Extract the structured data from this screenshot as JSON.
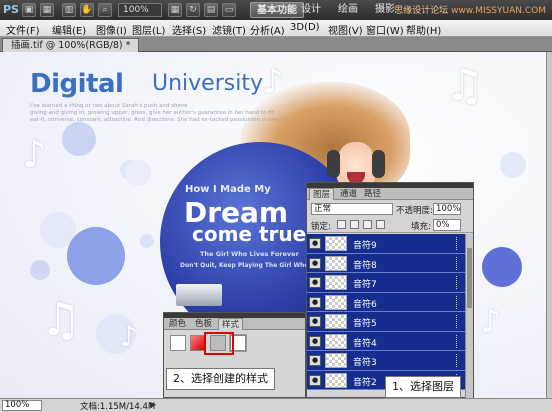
{
  "app": {
    "logo": "PS"
  },
  "toolbar": {
    "zoom": "100%",
    "workspace_basic": "基本功能",
    "workspace_design": "设计",
    "workspace_paint": "绘画",
    "workspace_more": "摄影",
    "watermark_brand": "思缘设计论坛",
    "watermark_site": "www.MISSYUAN.COM"
  },
  "menu": {
    "items": [
      "文件(F)",
      "编辑(E)",
      "图像(I)",
      "图层(L)",
      "选择(S)",
      "滤镜(T)",
      "分析(A)",
      "3D(D)",
      "视图(V)",
      "窗口(W)",
      "帮助(H)"
    ]
  },
  "document": {
    "tab_title": "插画.tif @ 100%(RGB/8) *"
  },
  "canvas": {
    "title_digital": "Digital",
    "title_university": "University",
    "small_text": [
      "I've learned a thing or two about Sarah's push and shove",
      "giving and giving in, growing upper, gives, give her author's guarantee in her hand to fit",
      "eat-it, converse, constant, attractive. And directions. She had ex-tacked passionate university"
    ],
    "how": "How I Made My",
    "dream": "Dream",
    "come_true": "come true!",
    "girl_who": "The Girl Who Lives Forever",
    "dont_quit": "Don't Quit, Keep Playing The Girl Who"
  },
  "layers_panel": {
    "tabs": [
      "图层",
      "通道",
      "路径"
    ],
    "blend_mode": "正常",
    "opacity_label": "不透明度:",
    "opacity_value": "100%",
    "lock_label": "锁定:",
    "fill_label": "填充:",
    "fill_value": "0%",
    "layers": [
      {
        "name": "音符9",
        "visible": true
      },
      {
        "name": "音符8",
        "visible": true
      },
      {
        "name": "音符7",
        "visible": true
      },
      {
        "name": "音符6",
        "visible": true
      },
      {
        "name": "音符5",
        "visible": true
      },
      {
        "name": "音符4",
        "visible": true
      },
      {
        "name": "音符3",
        "visible": true
      },
      {
        "name": "音符2",
        "visible": true
      }
    ]
  },
  "styles_panel": {
    "tabs": [
      "颜色",
      "色板",
      "样式"
    ]
  },
  "callouts": {
    "style": "2、选择创建的样式",
    "layers": "1、选择图层"
  },
  "status": {
    "zoom": "100%",
    "doc": "文档:1.15M/14.4M"
  },
  "colors": {
    "brand_blue": "#3b6fc2",
    "selection_blue": "#142d8f",
    "highlight_red": "#e00000"
  }
}
